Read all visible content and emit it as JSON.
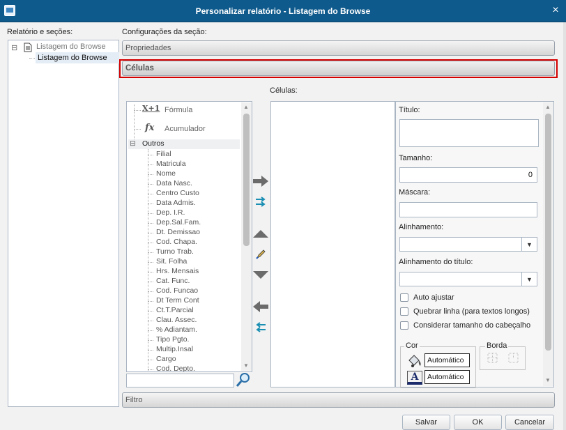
{
  "window": {
    "title": "Personalizar relatório - Listagem do Browse",
    "close_glyph": "×"
  },
  "left": {
    "label": "Relatório e seções:",
    "tree": [
      {
        "label": "Listagem do Browse",
        "expander": "⊟",
        "icon": "document-icon"
      },
      {
        "label": "Listagem do Browse"
      }
    ]
  },
  "config": {
    "label": "Configurações da seção:",
    "sections": [
      "Propriedades",
      "Células",
      "Filtro"
    ]
  },
  "fields": {
    "items_top": [
      "Fórmula",
      "Acumulador"
    ],
    "formula_icon_text": "X+1",
    "accumulator_icon_text": "fx",
    "group": "Outros",
    "group_expander": "⊟",
    "items": [
      "Filial",
      "Matricula",
      "Nome",
      "Data Nasc.",
      "Centro Custo",
      "Data Admis.",
      "Dep. I.R.",
      "Dep.Sal.Fam.",
      "Dt. Demissao",
      "Cod. Chapa.",
      "Turno Trab.",
      "Sit. Folha",
      "Hrs. Mensais",
      "Cat. Func.",
      "Cod. Funcao",
      "Dt Term Cont",
      "Ct.T.Parcial",
      "Clau. Assec.",
      "% Adiantam.",
      "Tipo Pgto.",
      "Multip.Insal",
      "Cargo",
      "Cod. Depto."
    ],
    "search_value": ""
  },
  "cells": {
    "label": "Células:"
  },
  "properties": {
    "title_label": "Título:",
    "title_value": "",
    "size_label": "Tamanho:",
    "size_value": "0",
    "mask_label": "Máscara:",
    "mask_value": "",
    "align_label": "Alinhamento:",
    "align_value": "",
    "title_align_label": "Alinhamento do título:",
    "title_align_value": "",
    "checkboxes": [
      "Auto ajustar",
      "Quebrar linha (para textos longos)",
      "Considerar tamanho do cabeçalho"
    ],
    "color_group": "Cor",
    "color_fill": "Automático",
    "color_font": "Automático",
    "font_color_glyph": "A",
    "border_group": "Borda"
  },
  "buttons": {
    "save": "Salvar",
    "ok": "OK",
    "cancel": "Cancelar"
  },
  "colors": {
    "titlebar": "#0e5a8c",
    "highlight": "#d40000",
    "arrow": "#6b6b6b",
    "swap": "#1a8fb3"
  }
}
